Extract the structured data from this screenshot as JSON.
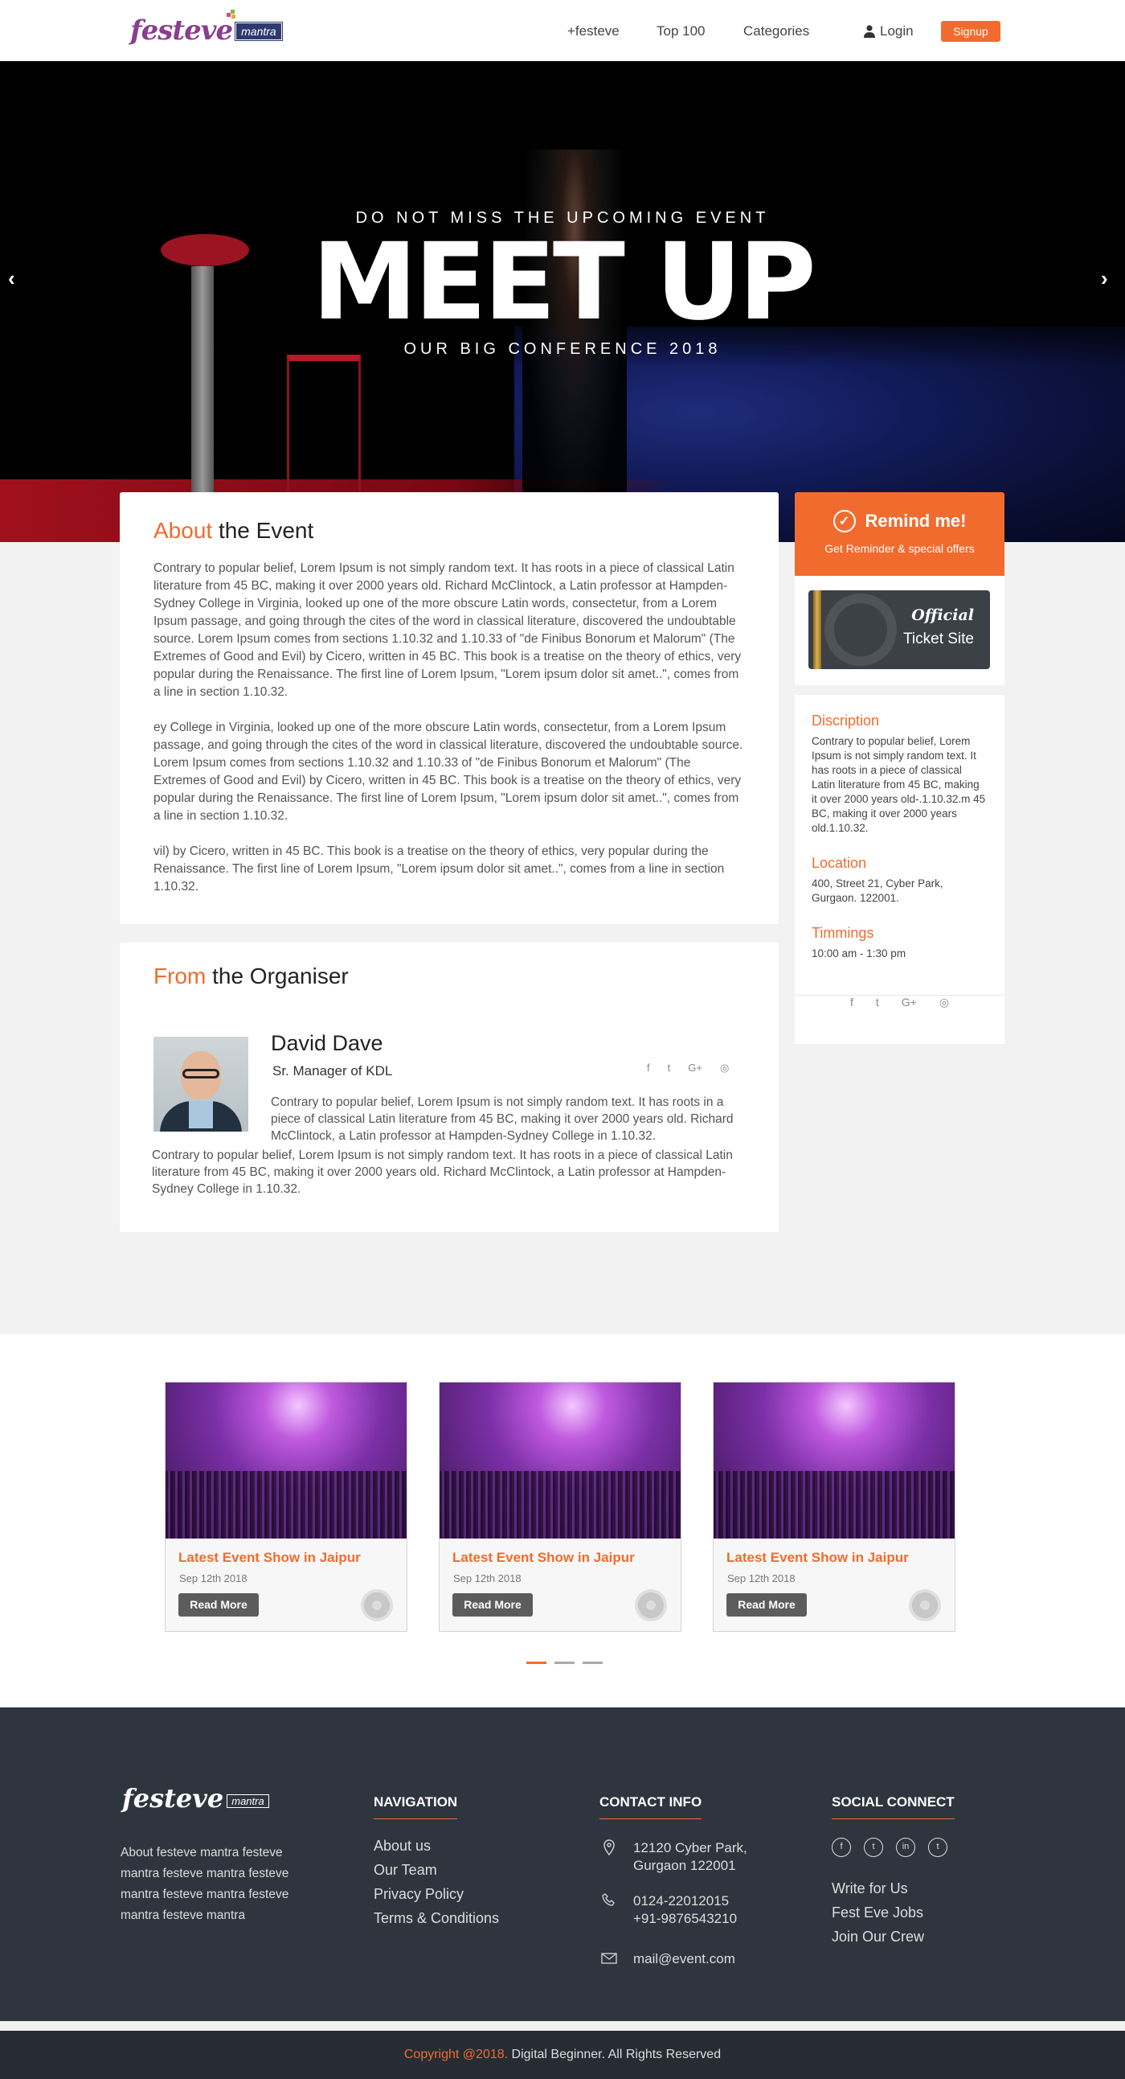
{
  "header": {
    "logo_word": "festeve",
    "logo_tag": "mantra",
    "nav": [
      "+festeve",
      "Top 100",
      "Categories"
    ],
    "login": "Login",
    "signup": "Signup"
  },
  "hero": {
    "pre": "DO NOT MISS THE UPCOMING EVENT",
    "title": "MEET UP",
    "post": "OUR BIG CONFERENCE 2018",
    "prev": "‹",
    "next": "›"
  },
  "about": {
    "title_hl": "About",
    "title_rest": " the Event",
    "paragraphs": [
      "Contrary to popular belief, Lorem Ipsum is not simply random text. It has roots in a piece of classical Latin literature from 45 BC, making it over 2000 years old. Richard McClintock, a Latin professor at Hampden-Sydney College in Virginia, looked up one of the more obscure Latin words, consectetur, from a Lorem Ipsum passage, and going through the cites of the word in classical literature, discovered the undoubtable source. Lorem Ipsum comes from sections 1.10.32 and 1.10.33 of \"de Finibus Bonorum et Malorum\" (The Extremes of Good and Evil) by Cicero, written in 45 BC. This book is a treatise on the theory of ethics, very popular during the Renaissance. The first line of Lorem Ipsum, \"Lorem ipsum dolor sit amet..\", comes from a line in section 1.10.32.",
      "ey College in Virginia, looked up one of the more obscure Latin words, consectetur, from a Lorem Ipsum passage, and going through the cites of the word in classical literature, discovered the undoubtable source. Lorem Ipsum comes from sections 1.10.32 and 1.10.33 of \"de Finibus Bonorum et Malorum\" (The Extremes of Good and Evil) by Cicero, written in 45 BC. This book is a treatise on the theory of ethics, very popular during the Renaissance. The first line of Lorem Ipsum, \"Lorem ipsum dolor sit amet..\", comes from a line in section 1.10.32.",
      "vil) by Cicero, written in 45 BC. This book is a treatise on the theory of ethics, very popular during the Renaissance. The first line of Lorem Ipsum, \"Lorem ipsum dolor sit amet..\", comes from a line in section 1.10.32."
    ]
  },
  "organiser": {
    "title_hl": "From",
    "title_rest": " the Organiser",
    "name": "David Dave",
    "role": "Sr. Manager of KDL",
    "bio1": "Contrary to popular belief, Lorem Ipsum is not simply random text. It has roots in a piece of classical Latin literature from 45 BC, making it over 2000 years old. Richard McClintock, a Latin professor at Hampden-Sydney College in  1.10.32.",
    "bio2": "Contrary to popular belief, Lorem Ipsum is not simply random text. It has roots in a piece of classical Latin literature from 45 BC, making it over 2000 years old. Richard McClintock, a Latin professor at Hampden-Sydney College in  1.10.32.",
    "social": [
      "f",
      "t",
      "G+",
      "◎"
    ]
  },
  "sidebar": {
    "remind_title": "Remind me!",
    "remind_sub": "Get Reminder & special offers",
    "ticket_official": "Official",
    "ticket_site": "Ticket Site",
    "description_h": "Discription",
    "description": "Contrary to popular belief, Lorem Ipsum is not simply random text. It has roots in a piece of classical Latin literature from 45 BC, making it over 2000 years old-.1.10.32.m 45 BC, making it over 2000 years old.1.10.32.",
    "location_h": "Location",
    "location": "400, Street 21, Cyber Park, Gurgaon. 122001.",
    "timings_h": "Timmings",
    "timings": "10:00 am - 1:30 pm",
    "social": [
      "f",
      "t",
      "G+",
      "◎"
    ]
  },
  "events": [
    {
      "title": "Latest Event Show in Jaipur",
      "date": "Sep 12th 2018",
      "button": "Read More"
    },
    {
      "title": "Latest Event Show in Jaipur",
      "date": "Sep 12th 2018",
      "button": "Read More"
    },
    {
      "title": "Latest Event Show in Jaipur",
      "date": "Sep 12th 2018",
      "button": "Read More"
    }
  ],
  "footer": {
    "logo_word": "festeve",
    "logo_tag": "mantra",
    "about": "About festeve mantra festeve mantra  festeve mantra festeve mantra festeve mantra festeve mantra festeve mantra",
    "nav_h": "NAVIGATION",
    "nav": [
      "About us",
      "Our Team",
      "Privacy Policy",
      "Terms & Conditions"
    ],
    "contact_h": "CONTACT INFO",
    "address": [
      "12120 Cyber Park,",
      "Gurgaon 122001"
    ],
    "phones": [
      "0124-22012015",
      "+91-9876543210"
    ],
    "email": "mail@event.com",
    "social_h": "SOCIAL CONNECT",
    "social_icons": [
      "f",
      "t",
      "in",
      "t"
    ],
    "social_links": [
      "Write for Us",
      "Fest Eve Jobs",
      "Join Our Crew"
    ],
    "copyright_hl": "Copyright @2018.",
    "copyright_rest": " Digital Beginner. All Rights Reserved"
  },
  "colors": {
    "accent": "#f26b2e",
    "footer_bg": "#2e353e",
    "copyright_bg": "#262c34"
  }
}
